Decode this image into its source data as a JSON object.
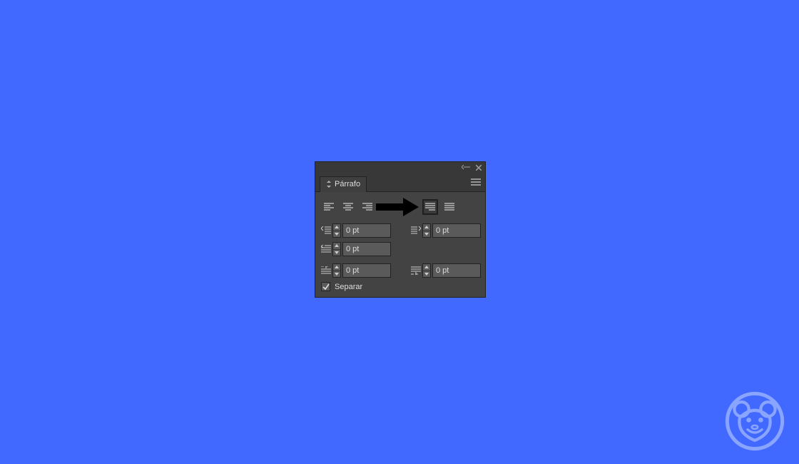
{
  "panel": {
    "title": "Párrafo",
    "indent_left": "0 pt",
    "indent_right": "0 pt",
    "indent_firstline": "0 pt",
    "space_before": "0 pt",
    "space_after": "0 pt",
    "hyphenate_label": "Separar",
    "hyphenate_checked": true
  }
}
